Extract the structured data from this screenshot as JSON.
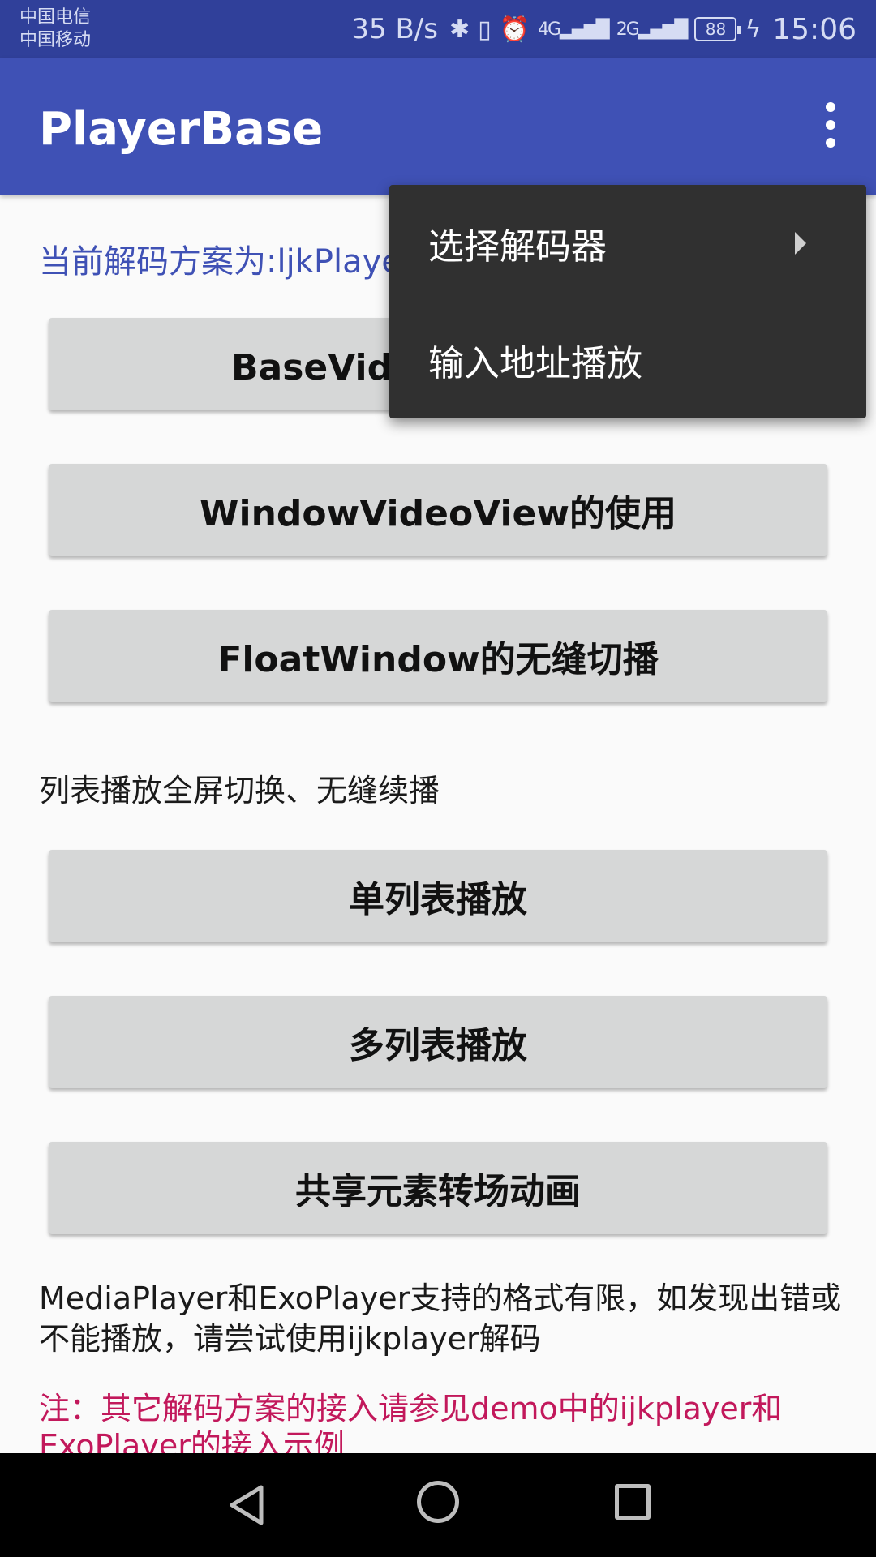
{
  "status_bar": {
    "carrier_1": "中国电信",
    "carrier_2": "中国移动",
    "net_speed": "35 B/s",
    "bluetooth_icon": "bluetooth-icon",
    "vibrate_icon": "vibrate-icon",
    "alarm_icon": "alarm-icon",
    "signal_4g": "4G",
    "signal_2g": "2G",
    "battery_level": "88",
    "time": "15:06"
  },
  "app_bar": {
    "title": "PlayerBase",
    "overflow_icon": "more-vert-icon"
  },
  "content": {
    "decoder_label": "当前解码方案为:ljkPlayer",
    "buttons": [
      "BaseVideoView的使用",
      "WindowVideoView的使用",
      "FloatWindow的无缝切播"
    ],
    "list_section_label": "列表播放全屏切换、无缝续播",
    "list_buttons": [
      "单列表播放",
      "多列表播放",
      "共享元素转场动画"
    ],
    "format_note": "MediaPlayer和ExoPlayer支持的格式有限，如发现出错或不能播放，请尝试使用ijkplayer解码",
    "integration_note": "注：其它解码方案的接入请参见demo中的ijkplayer和ExoPlayer的接入示例"
  },
  "popup_menu": {
    "items": [
      {
        "label": "选择解码器",
        "has_submenu": true
      },
      {
        "label": "输入地址播放",
        "has_submenu": false
      }
    ]
  },
  "nav_bar": {
    "back_icon": "back-triangle-icon",
    "home_icon": "home-circle-icon",
    "recents_icon": "recents-square-icon"
  },
  "colors": {
    "primary": "#3f51b5",
    "status_bar": "#30409a",
    "accent_note": "#c2185b",
    "button_bg": "#d6d7d7",
    "menu_bg": "#303030"
  }
}
